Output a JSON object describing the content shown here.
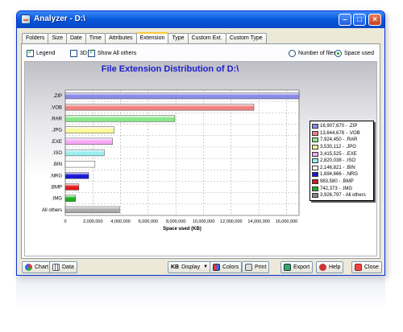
{
  "window": {
    "title": "Analyzer - D:\\"
  },
  "tabs": [
    {
      "label": "Folders",
      "active": false
    },
    {
      "label": "Size",
      "active": false
    },
    {
      "label": "Date",
      "active": false
    },
    {
      "label": "Time",
      "active": false
    },
    {
      "label": "Attributes",
      "active": false
    },
    {
      "label": "Extension",
      "active": true
    },
    {
      "label": "Type",
      "active": false
    },
    {
      "label": "Custom Ext.",
      "active": false
    },
    {
      "label": "Custom Type",
      "active": false
    }
  ],
  "options": {
    "legend": {
      "label": "Legend",
      "checked": true
    },
    "three_d": {
      "label": "3D",
      "checked": false
    },
    "show_all_others": {
      "label": "Show All others",
      "checked": true
    },
    "number_of_files": {
      "label": "Number of files",
      "selected": false
    },
    "space_used": {
      "label": "Space used",
      "selected": true
    }
  },
  "chart_data": {
    "type": "bar",
    "orientation": "horizontal",
    "title": "File Extension Distribution of D:\\",
    "xlabel": "Space used (KB)",
    "ylabel": "",
    "xlim": [
      0,
      16907670
    ],
    "grid": true,
    "legend_position": "right",
    "categories": [
      ".ZIP",
      ".VOB",
      ".RAR",
      ".JPG",
      ".EXE",
      ".ISO",
      ".BIN",
      ".NRG",
      ".BMP",
      ".IMG",
      "All others"
    ],
    "values": [
      16907670,
      13644678,
      7924450,
      3530112,
      3415525,
      2820038,
      2146821,
      1694666,
      983580,
      742373,
      3926797
    ],
    "x_ticks": [
      {
        "value": 0,
        "label": "0"
      },
      {
        "value": 2000000,
        "label": "2,000,000"
      },
      {
        "value": 4000000,
        "label": "4,000,000"
      },
      {
        "value": 6000000,
        "label": "6,000,000"
      },
      {
        "value": 8000000,
        "label": "8,000,000"
      },
      {
        "value": 10000000,
        "label": "10,000,000"
      },
      {
        "value": 12000000,
        "label": "12,000,000"
      },
      {
        "value": 14000000,
        "label": "14,000,000"
      },
      {
        "value": 16000000,
        "label": "16,000,000"
      }
    ],
    "colors": [
      "#8a8ae8",
      "#f08080",
      "#88e888",
      "#fafa99",
      "#f5a8f5",
      "#99eeee",
      "#ffffff",
      "#1a1ad0",
      "#e01a1a",
      "#20b020",
      "#aaaaaa"
    ],
    "legend_entries": [
      "16,907,670 - .ZIP",
      "13,644,678 - .VOB",
      "7,924,450 - .RAR",
      "3,530,112 - .JPG",
      "3,415,525 - .EXE",
      "2,820,038 - .ISO",
      "2,146,821 - .BIN",
      "1,694,666 - .NRG",
      "983,580 - .BMP",
      "742,373 - .IMG",
      "3,926,797 - All others"
    ],
    "legend_colors": [
      "#8a8ae8",
      "#f08080",
      "#88e888",
      "#fafa99",
      "#f5a8f5",
      "#99eeee",
      "#ffffff",
      "#1a1ad0",
      "#cc1a1a",
      "#20b020",
      "#888888"
    ]
  },
  "bottom_bar": {
    "chart": "Chart",
    "data": "Data",
    "display": "Display",
    "display_unit": "KB",
    "colors": "Colors",
    "print": "Print",
    "export": "Export",
    "help": "Help",
    "close": "Close"
  }
}
